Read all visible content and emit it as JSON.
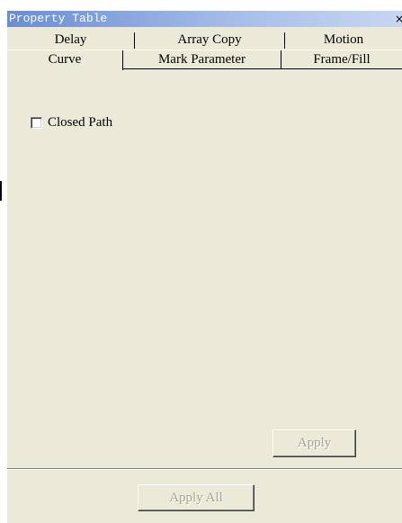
{
  "window": {
    "title": "Property Table",
    "close_glyph": "×"
  },
  "tabs": {
    "row_top": [
      {
        "label": "Delay"
      },
      {
        "label": "Array Copy"
      },
      {
        "label": "Motion"
      }
    ],
    "row_bottom": [
      {
        "label": "Curve",
        "active": true
      },
      {
        "label": "Mark Parameter"
      },
      {
        "label": "Frame/Fill"
      }
    ]
  },
  "curve": {
    "closed_path_label": "Closed Path",
    "closed_path_checked": false
  },
  "buttons": {
    "apply_label": "Apply",
    "apply_all_label": "Apply All",
    "apply_enabled": false,
    "apply_all_enabled": false
  },
  "colors": {
    "panel_bg": "#ece9d8",
    "title_gradient_start": "#6a8dd2",
    "disabled_text": "#a6a49a"
  }
}
